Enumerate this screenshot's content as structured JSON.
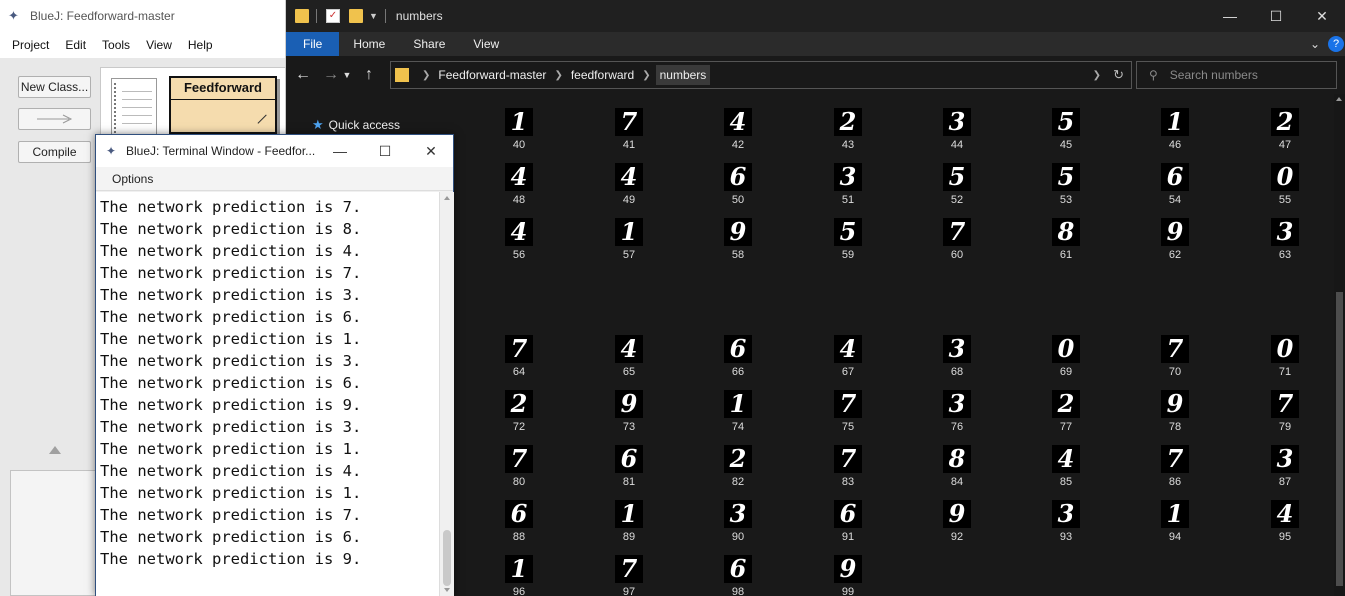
{
  "bluej": {
    "title": "BlueJ:  Feedforward-master",
    "menu": [
      "Project",
      "Edit",
      "Tools",
      "View",
      "Help"
    ],
    "buttons": {
      "new_class": "New Class...",
      "compile": "Compile"
    },
    "class_name": "Feedforward"
  },
  "explorer": {
    "title": "numbers",
    "ribbon_tabs": [
      "File",
      "Home",
      "Share",
      "View"
    ],
    "breadcrumb": [
      "Feedforward-master",
      "feedforward",
      "numbers"
    ],
    "search_placeholder": "Search numbers",
    "quick_access": "Quick access",
    "files": [
      {
        "digit": "1",
        "name": "40"
      },
      {
        "digit": "7",
        "name": "41"
      },
      {
        "digit": "4",
        "name": "42"
      },
      {
        "digit": "2",
        "name": "43"
      },
      {
        "digit": "3",
        "name": "44"
      },
      {
        "digit": "5",
        "name": "45"
      },
      {
        "digit": "1",
        "name": "46"
      },
      {
        "digit": "2",
        "name": "47"
      },
      {
        "digit": "4",
        "name": "48"
      },
      {
        "digit": "4",
        "name": "49"
      },
      {
        "digit": "6",
        "name": "50"
      },
      {
        "digit": "3",
        "name": "51"
      },
      {
        "digit": "5",
        "name": "52"
      },
      {
        "digit": "5",
        "name": "53"
      },
      {
        "digit": "6",
        "name": "54"
      },
      {
        "digit": "0",
        "name": "55"
      },
      {
        "digit": "4",
        "name": "56"
      },
      {
        "digit": "1",
        "name": "57"
      },
      {
        "digit": "9",
        "name": "58"
      },
      {
        "digit": "5",
        "name": "59"
      },
      {
        "digit": "7",
        "name": "60"
      },
      {
        "digit": "8",
        "name": "61"
      },
      {
        "digit": "9",
        "name": "62"
      },
      {
        "digit": "3",
        "name": "63"
      },
      {
        "digit": "7",
        "name": "64"
      },
      {
        "digit": "4",
        "name": "65"
      },
      {
        "digit": "6",
        "name": "66"
      },
      {
        "digit": "4",
        "name": "67"
      },
      {
        "digit": "3",
        "name": "68"
      },
      {
        "digit": "0",
        "name": "69"
      },
      {
        "digit": "7",
        "name": "70"
      },
      {
        "digit": "0",
        "name": "71"
      },
      {
        "digit": "2",
        "name": "72"
      },
      {
        "digit": "9",
        "name": "73"
      },
      {
        "digit": "1",
        "name": "74"
      },
      {
        "digit": "7",
        "name": "75"
      },
      {
        "digit": "3",
        "name": "76"
      },
      {
        "digit": "2",
        "name": "77"
      },
      {
        "digit": "9",
        "name": "78"
      },
      {
        "digit": "7",
        "name": "79"
      },
      {
        "digit": "7",
        "name": "80"
      },
      {
        "digit": "6",
        "name": "81"
      },
      {
        "digit": "2",
        "name": "82"
      },
      {
        "digit": "7",
        "name": "83"
      },
      {
        "digit": "8",
        "name": "84"
      },
      {
        "digit": "4",
        "name": "85"
      },
      {
        "digit": "7",
        "name": "86"
      },
      {
        "digit": "3",
        "name": "87"
      },
      {
        "digit": "6",
        "name": "88"
      },
      {
        "digit": "1",
        "name": "89"
      },
      {
        "digit": "3",
        "name": "90"
      },
      {
        "digit": "6",
        "name": "91"
      },
      {
        "digit": "9",
        "name": "92"
      },
      {
        "digit": "3",
        "name": "93"
      },
      {
        "digit": "1",
        "name": "94"
      },
      {
        "digit": "4",
        "name": "95"
      },
      {
        "digit": "1",
        "name": "96"
      },
      {
        "digit": "7",
        "name": "97"
      },
      {
        "digit": "6",
        "name": "98"
      },
      {
        "digit": "9",
        "name": "99"
      }
    ]
  },
  "terminal": {
    "title": "BlueJ: Terminal Window - Feedfor...",
    "menu": "Options",
    "lines": [
      "The network prediction is 7.",
      "The network prediction is 8.",
      "The network prediction is 4.",
      "The network prediction is 7.",
      "The network prediction is 3.",
      "The network prediction is 6.",
      "The network prediction is 1.",
      "The network prediction is 3.",
      "The network prediction is 6.",
      "The network prediction is 9.",
      "The network prediction is 3.",
      "The network prediction is 1.",
      "The network prediction is 4.",
      "The network prediction is 1.",
      "The network prediction is 7.",
      "The network prediction is 6.",
      "The network prediction is 9."
    ]
  },
  "colors": {
    "accent": "#1a5fb4",
    "class_fill": "#f5dcae",
    "explorer_bg": "#191919"
  },
  "icons": [
    "bluej-logo-icon",
    "folder-icon",
    "back-arrow-icon",
    "forward-arrow-icon",
    "up-arrow-icon",
    "refresh-icon",
    "search-icon",
    "star-icon",
    "minimize-icon",
    "maximize-icon",
    "close-icon"
  ]
}
